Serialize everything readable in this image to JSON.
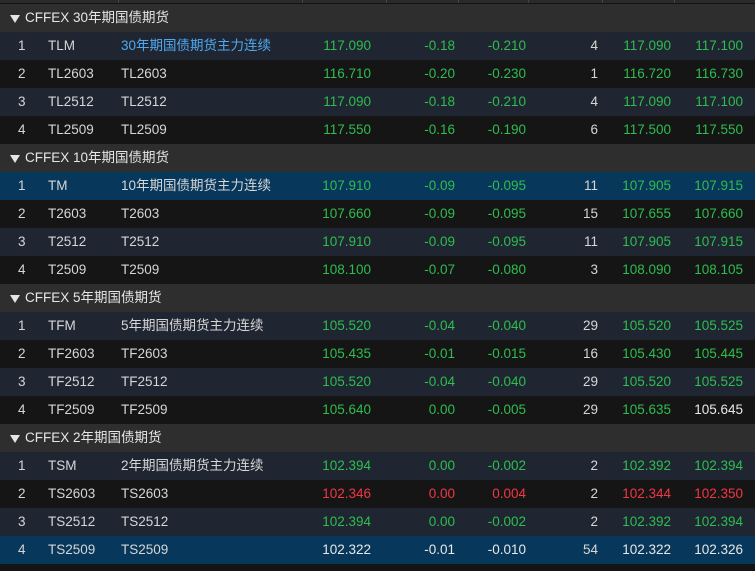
{
  "colors": {
    "up": "#f23645",
    "down": "#2ebd4e",
    "flat": "#e8e8e8",
    "link": "#4fa8f0",
    "selected": "#07375a"
  },
  "groups": [
    {
      "title": "CFFEX 30年期国债期货",
      "rows": [
        {
          "idx": "1",
          "code": "TLM",
          "name": "30年期国债期货主力连续",
          "last": "117.090",
          "chg": "-0.18",
          "pct": "-0.210",
          "vol": "4",
          "bid": "117.090",
          "ask": "117.100",
          "c": [
            "g",
            "g",
            "g",
            "g",
            "g"
          ],
          "name_link": true
        },
        {
          "idx": "2",
          "code": "TL2603",
          "name": "TL2603",
          "last": "116.710",
          "chg": "-0.20",
          "pct": "-0.230",
          "vol": "1",
          "bid": "116.720",
          "ask": "116.730",
          "c": [
            "g",
            "g",
            "g",
            "g",
            "g"
          ]
        },
        {
          "idx": "3",
          "code": "TL2512",
          "name": "TL2512",
          "last": "117.090",
          "chg": "-0.18",
          "pct": "-0.210",
          "vol": "4",
          "bid": "117.090",
          "ask": "117.100",
          "c": [
            "g",
            "g",
            "g",
            "g",
            "g"
          ]
        },
        {
          "idx": "4",
          "code": "TL2509",
          "name": "TL2509",
          "last": "117.550",
          "chg": "-0.16",
          "pct": "-0.190",
          "vol": "6",
          "bid": "117.500",
          "ask": "117.550",
          "c": [
            "g",
            "g",
            "g",
            "g",
            "g"
          ]
        }
      ]
    },
    {
      "title": "CFFEX 10年期国债期货",
      "rows": [
        {
          "idx": "1",
          "code": "TM",
          "name": "10年期国债期货主力连续",
          "last": "107.910",
          "chg": "-0.09",
          "pct": "-0.095",
          "vol": "11",
          "bid": "107.905",
          "ask": "107.915",
          "c": [
            "g",
            "g",
            "g",
            "g",
            "g"
          ],
          "selected": true
        },
        {
          "idx": "2",
          "code": "T2603",
          "name": "T2603",
          "last": "107.660",
          "chg": "-0.09",
          "pct": "-0.095",
          "vol": "15",
          "bid": "107.655",
          "ask": "107.660",
          "c": [
            "g",
            "g",
            "g",
            "g",
            "g"
          ]
        },
        {
          "idx": "3",
          "code": "T2512",
          "name": "T2512",
          "last": "107.910",
          "chg": "-0.09",
          "pct": "-0.095",
          "vol": "11",
          "bid": "107.905",
          "ask": "107.915",
          "c": [
            "g",
            "g",
            "g",
            "g",
            "g"
          ]
        },
        {
          "idx": "4",
          "code": "T2509",
          "name": "T2509",
          "last": "108.100",
          "chg": "-0.07",
          "pct": "-0.080",
          "vol": "3",
          "bid": "108.090",
          "ask": "108.105",
          "c": [
            "g",
            "g",
            "g",
            "g",
            "g"
          ]
        }
      ]
    },
    {
      "title": "CFFEX 5年期国债期货",
      "rows": [
        {
          "idx": "1",
          "code": "TFM",
          "name": "5年期国债期货主力连续",
          "last": "105.520",
          "chg": "-0.04",
          "pct": "-0.040",
          "vol": "29",
          "bid": "105.520",
          "ask": "105.525",
          "c": [
            "g",
            "g",
            "g",
            "g",
            "g"
          ]
        },
        {
          "idx": "2",
          "code": "TF2603",
          "name": "TF2603",
          "last": "105.435",
          "chg": "-0.01",
          "pct": "-0.015",
          "vol": "16",
          "bid": "105.430",
          "ask": "105.445",
          "c": [
            "g",
            "g",
            "g",
            "g",
            "g"
          ]
        },
        {
          "idx": "3",
          "code": "TF2512",
          "name": "TF2512",
          "last": "105.520",
          "chg": "-0.04",
          "pct": "-0.040",
          "vol": "29",
          "bid": "105.520",
          "ask": "105.525",
          "c": [
            "g",
            "g",
            "g",
            "g",
            "g"
          ]
        },
        {
          "idx": "4",
          "code": "TF2509",
          "name": "TF2509",
          "last": "105.640",
          "chg": "0.00",
          "pct": "-0.005",
          "vol": "29",
          "bid": "105.635",
          "ask": "105.645",
          "c": [
            "g",
            "g",
            "g",
            "g",
            "w"
          ]
        }
      ]
    },
    {
      "title": "CFFEX 2年期国债期货",
      "rows": [
        {
          "idx": "1",
          "code": "TSM",
          "name": "2年期国债期货主力连续",
          "last": "102.394",
          "chg": "0.00",
          "pct": "-0.002",
          "vol": "2",
          "bid": "102.392",
          "ask": "102.394",
          "c": [
            "g",
            "g",
            "g",
            "g",
            "g"
          ]
        },
        {
          "idx": "2",
          "code": "TS2603",
          "name": "TS2603",
          "last": "102.346",
          "chg": "0.00",
          "pct": "0.004",
          "vol": "2",
          "bid": "102.344",
          "ask": "102.350",
          "c": [
            "r",
            "r",
            "r",
            "r",
            "r"
          ]
        },
        {
          "idx": "3",
          "code": "TS2512",
          "name": "TS2512",
          "last": "102.394",
          "chg": "0.00",
          "pct": "-0.002",
          "vol": "2",
          "bid": "102.392",
          "ask": "102.394",
          "c": [
            "g",
            "g",
            "g",
            "g",
            "g"
          ]
        },
        {
          "idx": "4",
          "code": "TS2509",
          "name": "TS2509",
          "last": "102.322",
          "chg": "-0.01",
          "pct": "-0.010",
          "vol": "54",
          "bid": "102.322",
          "ask": "102.326",
          "c": [
            "w",
            "w",
            "w",
            "w",
            "w"
          ],
          "selected": true
        }
      ]
    }
  ]
}
